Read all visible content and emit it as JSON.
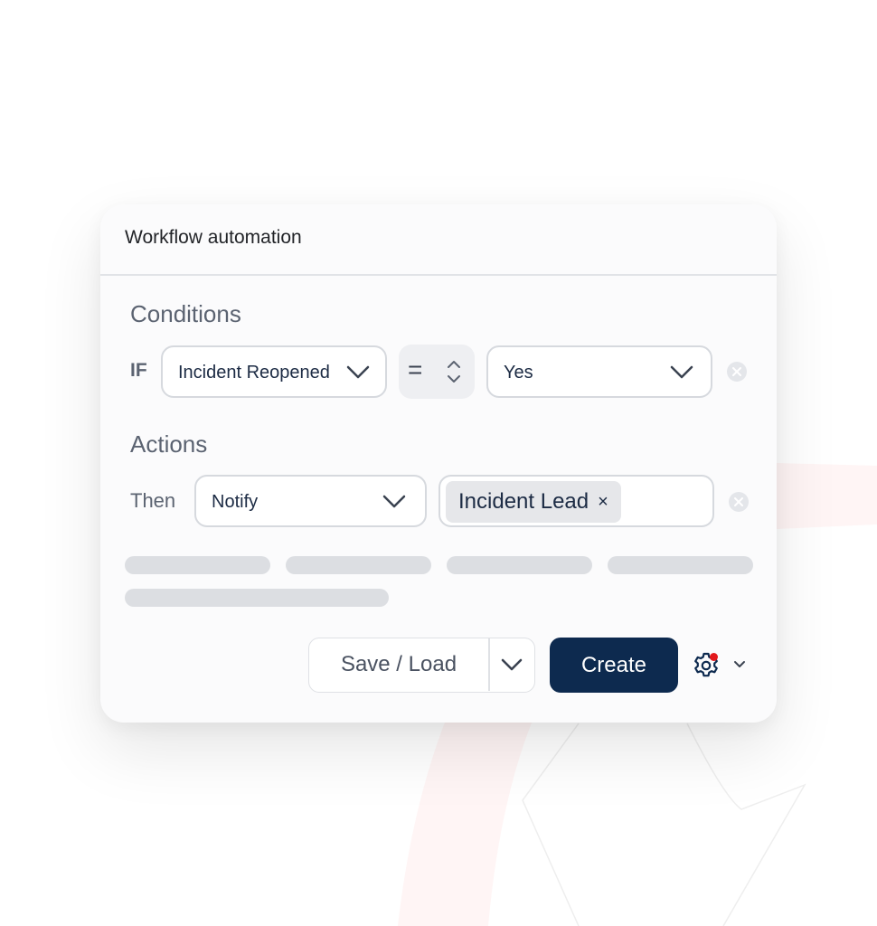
{
  "card": {
    "title": "Workflow automation"
  },
  "conditions": {
    "heading": "Conditions",
    "row_label": "IF",
    "field_value": "Incident Reopened",
    "operator_value": "=",
    "value_value": "Yes"
  },
  "actions": {
    "heading": "Actions",
    "row_label": "Then",
    "action_value": "Notify",
    "recipient_chip": "Incident Lead",
    "chip_remove": "×"
  },
  "footer": {
    "save_load_label": "Save / Load",
    "create_label": "Create"
  },
  "icons": {
    "field_chevron": "chevron-down-icon",
    "operator_stepper": "up-down-icon",
    "value_chevron": "chevron-down-icon",
    "remove_condition": "close-circle-icon",
    "remove_action": "close-circle-icon",
    "save_load_dropdown": "chevron-down-icon",
    "settings": "gear-icon",
    "settings_dropdown": "chevron-down-icon"
  },
  "colors": {
    "primary_button": "#0d2a4f",
    "notification_dot": "#e3191c",
    "text_primary": "#1c2b44",
    "text_muted": "#5b6371"
  }
}
